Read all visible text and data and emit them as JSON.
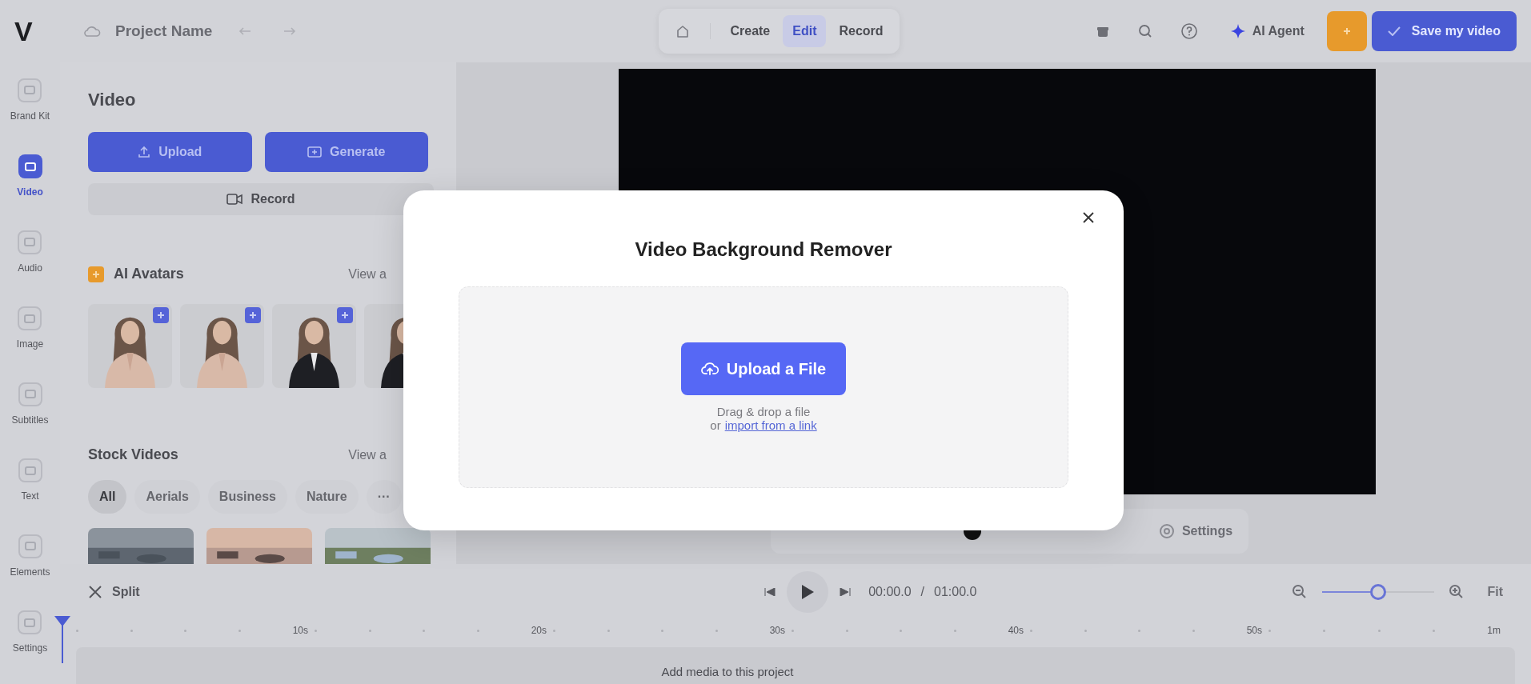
{
  "topbar": {
    "logo": "V",
    "project_name": "Project Name",
    "nav": [
      {
        "label": "Create",
        "selected": false
      },
      {
        "label": "Edit",
        "selected": true
      },
      {
        "label": "Record",
        "selected": false
      }
    ],
    "ai_agent": "AI Agent",
    "save": "Save my video"
  },
  "rail": [
    {
      "label": "Brand Kit",
      "selected": false
    },
    {
      "label": "Video",
      "selected": true
    },
    {
      "label": "Audio",
      "selected": false
    },
    {
      "label": "Image",
      "selected": false
    },
    {
      "label": "Subtitles",
      "selected": false
    },
    {
      "label": "Text",
      "selected": false
    },
    {
      "label": "Elements",
      "selected": false
    },
    {
      "label": "Settings",
      "selected": false
    }
  ],
  "panel": {
    "title": "Video",
    "upload": "Upload",
    "generate": "Generate",
    "record": "Record",
    "avatars_title": "AI Avatars",
    "avatars_link": "View a",
    "stock_title": "Stock Videos",
    "stock_link": "View a",
    "chips": [
      {
        "label": "All",
        "selected": true
      },
      {
        "label": "Aerials",
        "selected": false
      },
      {
        "label": "Business",
        "selected": false
      },
      {
        "label": "Nature",
        "selected": false
      },
      {
        "label": "···",
        "selected": false
      }
    ]
  },
  "canvas_bar": {
    "settings": "Settings"
  },
  "timeline": {
    "split": "Split",
    "current": "00:00.0",
    "separator": "/",
    "total": "01:00.0",
    "zoom": {
      "level": 0.5
    },
    "fit": "Fit",
    "ticks": [
      "10s",
      "20s",
      "30s",
      "40s",
      "50s",
      "1m"
    ],
    "track": "Add media to this project"
  },
  "dialog": {
    "title": "Video Background Remover",
    "upload": "Upload a File",
    "hint": "Drag & drop a file",
    "or": "or",
    "link": "import from a link"
  }
}
